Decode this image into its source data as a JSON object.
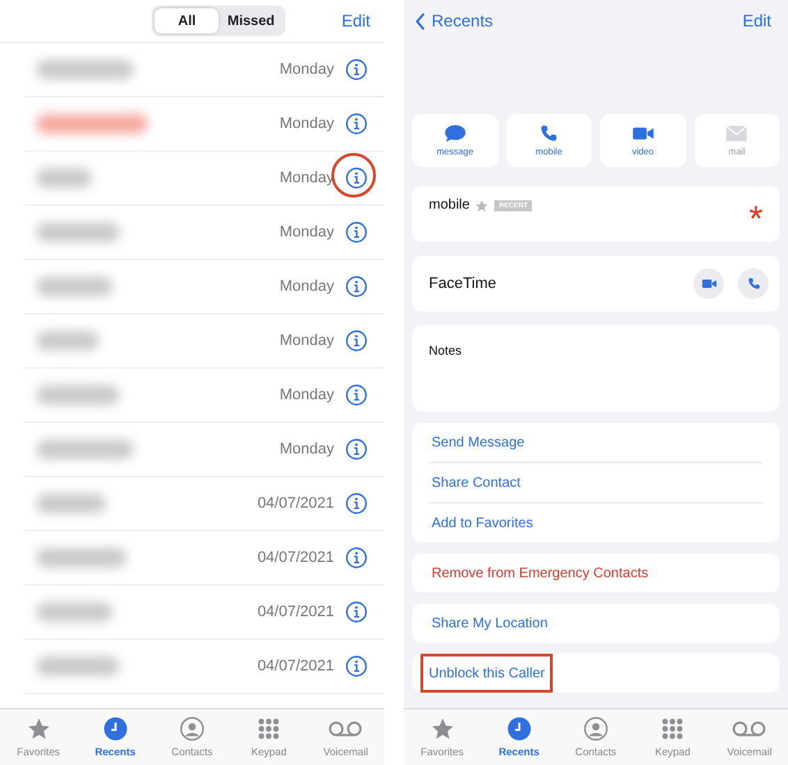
{
  "recents_screen": {
    "segments": [
      {
        "label": "All",
        "selected": true
      },
      {
        "label": "Missed",
        "selected": false
      }
    ],
    "edit": "Edit",
    "calls": [
      {
        "date": "Monday",
        "missed": false,
        "highlighted": false
      },
      {
        "date": "Monday",
        "missed": true,
        "highlighted": false
      },
      {
        "date": "Monday",
        "missed": false,
        "highlighted": true
      },
      {
        "date": "Monday",
        "missed": false,
        "highlighted": false
      },
      {
        "date": "Monday",
        "missed": false,
        "highlighted": false
      },
      {
        "date": "Monday",
        "missed": false,
        "highlighted": false
      },
      {
        "date": "Monday",
        "missed": false,
        "highlighted": false
      },
      {
        "date": "Monday",
        "missed": false,
        "highlighted": false
      },
      {
        "date": "04/07/2021",
        "missed": false,
        "highlighted": false
      },
      {
        "date": "04/07/2021",
        "missed": false,
        "highlighted": false
      },
      {
        "date": "04/07/2021",
        "missed": false,
        "highlighted": false
      },
      {
        "date": "04/07/2021",
        "missed": false,
        "highlighted": false
      }
    ],
    "tab_bar": [
      {
        "kind": "favorites",
        "label": "Favorites",
        "selected": false
      },
      {
        "kind": "recents",
        "label": "Recents",
        "selected": true
      },
      {
        "kind": "contacts",
        "label": "Contacts",
        "selected": false
      },
      {
        "kind": "keypad",
        "label": "Keypad",
        "selected": false
      },
      {
        "kind": "voicemail",
        "label": "Voicemail",
        "selected": false
      }
    ]
  },
  "detail_screen": {
    "back": "Recents",
    "edit": "Edit",
    "actions": [
      {
        "kind": "message",
        "label": "message",
        "disabled": false
      },
      {
        "kind": "mobile",
        "label": "mobile",
        "disabled": false
      },
      {
        "kind": "video",
        "label": "video",
        "disabled": false
      },
      {
        "kind": "mail",
        "label": "mail",
        "disabled": true
      }
    ],
    "phone": {
      "label": "mobile",
      "badge": "RECENT",
      "marker": "*"
    },
    "facetime": "FaceTime",
    "notes": "Notes",
    "groups": [
      [
        {
          "label": "Send Message",
          "destructive": false,
          "highlighted": false
        },
        {
          "label": "Share Contact",
          "destructive": false,
          "highlighted": false
        },
        {
          "label": "Add to Favorites",
          "destructive": false,
          "highlighted": false
        }
      ],
      [
        {
          "label": "Remove from Emergency Contacts",
          "destructive": true,
          "highlighted": false
        }
      ],
      [
        {
          "label": "Share My Location",
          "destructive": false,
          "highlighted": false
        }
      ],
      [
        {
          "label": "Unblock this Caller",
          "destructive": false,
          "highlighted": true
        }
      ]
    ],
    "tab_bar": [
      {
        "kind": "favorites",
        "label": "Favorites",
        "selected": false
      },
      {
        "kind": "recents",
        "label": "Recents",
        "selected": true
      },
      {
        "kind": "contacts",
        "label": "Contacts",
        "selected": false
      },
      {
        "kind": "keypad",
        "label": "Keypad",
        "selected": false
      },
      {
        "kind": "voicemail",
        "label": "Voicemail",
        "selected": false
      }
    ]
  }
}
